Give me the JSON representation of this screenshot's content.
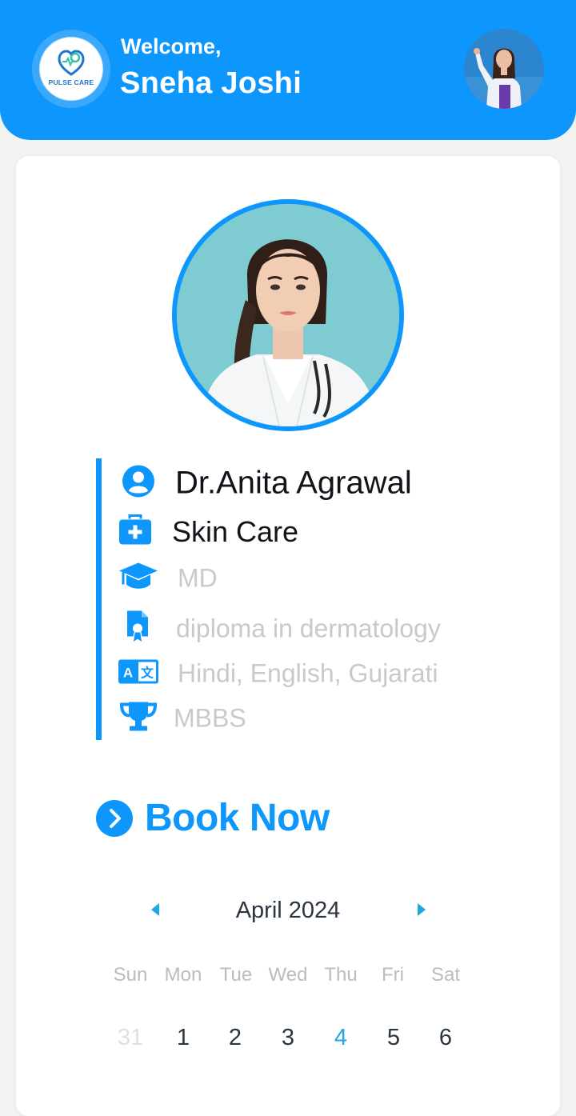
{
  "header": {
    "logo_text": "PULSE CARE",
    "welcome": "Welcome,",
    "user_name": "Sneha Joshi"
  },
  "doctor": {
    "name": "Dr.Anita Agrawal",
    "specialty": "Skin Care",
    "degree": "MD",
    "certification": "diploma in dermatology",
    "languages": "Hindi, English, Gujarati",
    "achievement": "MBBS"
  },
  "icons": {
    "name": "person-circle-icon",
    "specialty": "medical-kit-icon",
    "degree": "graduation-cap-icon",
    "certification": "certificate-document-icon",
    "languages": "translate-icon",
    "achievement": "trophy-icon"
  },
  "book_now": {
    "label": "Book Now"
  },
  "calendar": {
    "month_label": "April 2024",
    "weekdays": [
      "Sun",
      "Mon",
      "Tue",
      "Wed",
      "Thu",
      "Fri",
      "Sat"
    ],
    "days": [
      "31",
      "1",
      "2",
      "3",
      "4",
      "5",
      "6"
    ],
    "today": "4"
  },
  "colors": {
    "primary": "#0d96fb",
    "today": "#1fa7df",
    "muted_text": "#c9c9cc"
  }
}
